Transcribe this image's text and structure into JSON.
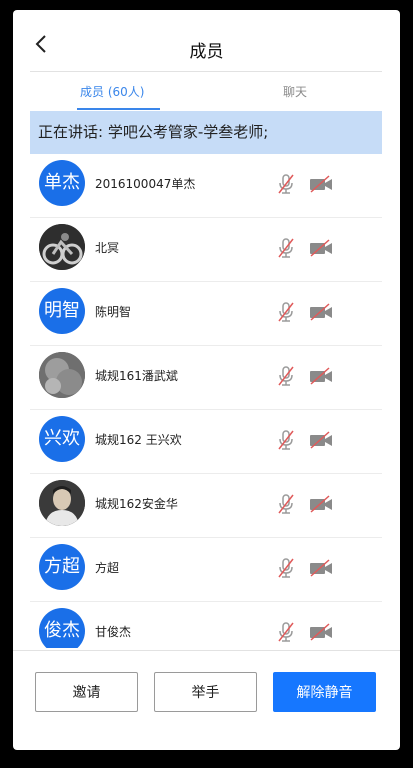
{
  "header": {
    "title": "成员"
  },
  "tabs": [
    {
      "label": "成员 (60人)",
      "active": true
    },
    {
      "label": "聊天",
      "active": false
    }
  ],
  "speaking_banner": "正在讲话: 学吧公考管家-学叁老师;",
  "members": [
    {
      "avatar_text": "单杰",
      "avatar_type": "initials",
      "name": "2016100047单杰"
    },
    {
      "avatar_text": "",
      "avatar_type": "photo-motorcycle",
      "name": "北冥"
    },
    {
      "avatar_text": "明智",
      "avatar_type": "initials",
      "name": "陈明智"
    },
    {
      "avatar_text": "",
      "avatar_type": "photo-blur",
      "name": "城规161潘武斌"
    },
    {
      "avatar_text": "兴欢",
      "avatar_type": "initials",
      "name": "城规162 王兴欢"
    },
    {
      "avatar_text": "",
      "avatar_type": "photo-person",
      "name": "城规162安金华"
    },
    {
      "avatar_text": "方超",
      "avatar_type": "initials",
      "name": "方超"
    },
    {
      "avatar_text": "俊杰",
      "avatar_type": "initials",
      "name": "甘俊杰"
    }
  ],
  "footer": {
    "invite_label": "邀请",
    "raise_hand_label": "举手",
    "unmute_label": "解除静音"
  },
  "colors": {
    "accent": "#1677ff",
    "avatar_blue": "#1a6fe8",
    "banner_bg": "#c6dcf7",
    "muted_icon": "#e05a5a"
  }
}
